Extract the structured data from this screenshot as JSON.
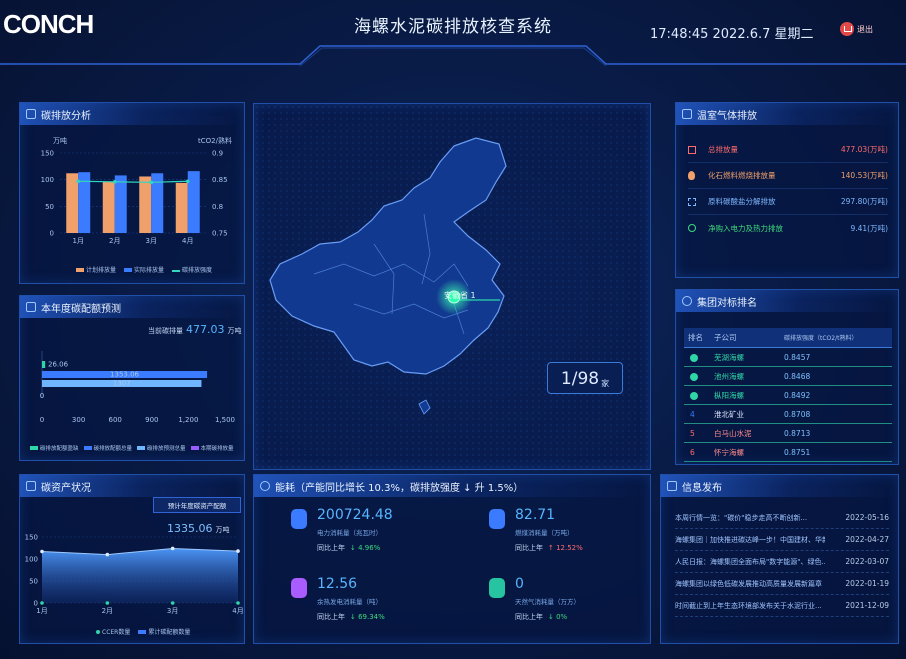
{
  "header": {
    "logo": "CONCH",
    "title": "海螺水泥碳排放核查系统",
    "clock": "17:48:45 2022.6.7 星期二",
    "logout": "退出"
  },
  "colors": {
    "bg": "#071333",
    "panel_border": "#1f4fa8",
    "accent_blue": "#3a7bff",
    "accent_orange": "#f0a06a",
    "accent_teal": "#2fd6c0",
    "accent_red": "#ff6b6b",
    "accent_green": "#3cdc7c"
  },
  "carbon_panel": {
    "title": "碳排放分析",
    "unit_left": "万吨",
    "unit_right": "tCO2/熟料",
    "legend": [
      "计划排放量",
      "实际排放量",
      "碳排放强度"
    ]
  },
  "quota_panel": {
    "title": "本年度碳配额预测",
    "current_label": "当前碳排量",
    "current_value": "477.03",
    "current_unit": "万吨",
    "bar_value_labels": [
      "26.06",
      "1353.06",
      "1307"
    ],
    "legend": [
      "碳排放配额盈缺",
      "碳排放配额总量",
      "碳排放预测总量",
      "本期碳排放量"
    ]
  },
  "assets_panel": {
    "title": "碳资产状况",
    "box_label": "预计年度碳资产配额",
    "value": "1335.06",
    "unit": "万吨",
    "legend": [
      "CCER数量",
      "累计碳配额数量"
    ]
  },
  "map_panel": {
    "marker_label": "安徽省 1",
    "counter_value": "1/98",
    "counter_unit": "家"
  },
  "metrics_panel": {
    "title": "能耗（产能同比增长 10.3%，碳排放强度 ↓ 升 1.5%）",
    "items": [
      {
        "value": "200724.48",
        "label": "电力消耗量（兆瓦时）",
        "compare_label": "同比上年",
        "compare_value": "↓ 4.96%",
        "icon": "power-icon",
        "color": "#3a7bff"
      },
      {
        "value": "82.71",
        "label": "燃煤消耗量（万吨）",
        "compare_label": "同比上年",
        "compare_value": "↑ 12.52%",
        "icon": "fire-icon",
        "color": "#3a7bff"
      },
      {
        "value": "12.56",
        "label": "余热发电消耗量（吨）",
        "compare_label": "同比上年",
        "compare_value": "↓ 69.34%",
        "icon": "waste-heat-icon",
        "color": "#a95cff"
      },
      {
        "value": "0",
        "label": "天然气消耗量（万方）",
        "compare_label": "同比上年",
        "compare_value": "↓ 0%",
        "icon": "gas-icon",
        "color": "#26c4a0"
      }
    ]
  },
  "ghg_panel": {
    "title": "温室气体排放",
    "rows": [
      {
        "icon": "factory-icon",
        "label": "总排放量",
        "value": "477.03(万吨)",
        "color": "#ff6b6b"
      },
      {
        "icon": "flame-icon",
        "label": "化石燃料燃烧排放量",
        "value": "140.53(万吨)",
        "color": "#f0a06a"
      },
      {
        "icon": "process-icon",
        "label": "原料碳酸盐分解排放",
        "value": "297.80(万吨)",
        "color": "#7fb8ff"
      },
      {
        "icon": "plug-icon",
        "label": "净购入电力及热力排放",
        "value": "9.41(万吨)",
        "color": "#3cdc7c"
      }
    ]
  },
  "ranking_panel": {
    "title": "集团对标排名",
    "headers": [
      "排名",
      "子公司",
      "碳排放强度（tCO2/t熟料）"
    ],
    "rows": [
      {
        "rank": "1",
        "name": "芜湖海螺",
        "value": "0.8457"
      },
      {
        "rank": "2",
        "name": "池州海螺",
        "value": "0.8468"
      },
      {
        "rank": "3",
        "name": "枞阳海螺",
        "value": "0.8492"
      },
      {
        "rank": "4",
        "name": "淮北矿业",
        "value": "0.8708"
      },
      {
        "rank": "5",
        "name": "白马山水泥",
        "value": "0.8713"
      },
      {
        "rank": "6",
        "name": "怀宁海螺",
        "value": "0.8751"
      }
    ]
  },
  "news_panel": {
    "title": "信息发布",
    "items": [
      {
        "text": "本周行情一览：\"碳价\"稳步走高不断创新...",
        "date": "2022-05-16"
      },
      {
        "text": "海螺集团｜加快推进碳达峰一步！中国建材、华新...",
        "date": "2022-04-27"
      },
      {
        "text": "人民日报：海螺集团全面布局\"数字能源\"、绿色...",
        "date": "2022-03-07"
      },
      {
        "text": "海螺集团以绿色低碳发展推动高质量发展新篇章",
        "date": "2022-01-19"
      },
      {
        "text": "时间截止到上年生态环境部发布关于水泥行业...",
        "date": "2021-12-09"
      }
    ]
  },
  "chart_data": [
    {
      "type": "bar",
      "title": "碳排放分析",
      "categories": [
        "1月",
        "2月",
        "3月",
        "4月"
      ],
      "series": [
        {
          "name": "计划排放量",
          "type": "bar",
          "values": [
            112,
            96,
            106,
            94
          ]
        },
        {
          "name": "实际排放量",
          "type": "bar",
          "values": [
            114,
            108,
            112,
            116
          ]
        },
        {
          "name": "碳排放强度",
          "type": "line",
          "axis": "right",
          "values": [
            0.847,
            0.846,
            0.845,
            0.847
          ]
        }
      ],
      "ylim": [
        0,
        150
      ],
      "yticks": [
        0,
        50,
        100,
        150
      ],
      "ylim_right": [
        0.75,
        0.9
      ],
      "yticks_right": [
        0.75,
        0.8,
        0.85,
        0.9
      ],
      "ylabel": "万吨",
      "ylabel_right": "tCO2/熟料",
      "grid": true,
      "legend": "bottom"
    },
    {
      "type": "bar",
      "orientation": "horizontal",
      "title": "本年度碳配额预测",
      "series": [
        {
          "name": "碳排放配额盈缺",
          "value": 26.06
        },
        {
          "name": "碳排放配额总量",
          "value": 1353.06
        },
        {
          "name": "碳排放预测总量",
          "value": 1307
        },
        {
          "name": "本期碳排放量",
          "value": 0
        }
      ],
      "xlim": [
        0,
        1500
      ],
      "xticks": [
        "0",
        "300",
        "600",
        "900",
        "1,200",
        "1,500"
      ],
      "legend": "bottom"
    },
    {
      "type": "area",
      "title": "碳资产状况",
      "categories": [
        "1月",
        "2月",
        "3月",
        "4月"
      ],
      "series": [
        {
          "name": "CCER数量",
          "values": [
            0,
            0,
            0,
            0
          ]
        },
        {
          "name": "累计碳配额数量",
          "values": [
            117,
            110,
            124,
            118
          ]
        }
      ],
      "ylim": [
        0,
        150
      ],
      "yticks": [
        0,
        50,
        100,
        150
      ],
      "legend": "bottom"
    }
  ]
}
